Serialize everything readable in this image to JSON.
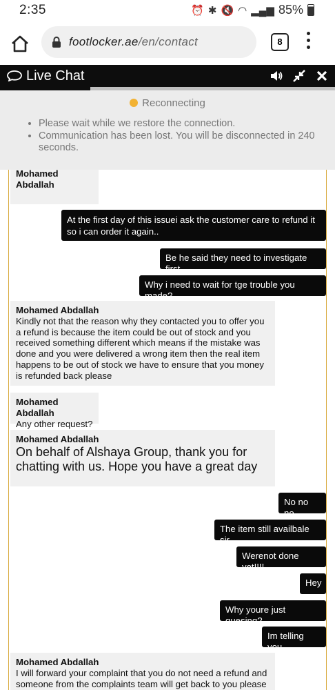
{
  "status_bar": {
    "time": "2:35",
    "battery": "85%"
  },
  "browser": {
    "url_domain": "footlocker.ae",
    "url_path": "/en/contact",
    "tab_count": "8"
  },
  "chat": {
    "title": "Live Chat",
    "status": "Reconnecting",
    "notices": [
      "Please wait while we restore the connection.",
      "Communication has been lost. You will be disconnected in 240 seconds."
    ]
  },
  "messages": [
    {
      "sender": "Mohamed Abdallah",
      "from": "agent",
      "text": ""
    },
    {
      "from": "user",
      "text": "At the first day of this issuei ask the customer care to refund it so i can order it again.."
    },
    {
      "from": "user",
      "text": "Be he said they need to investigate first"
    },
    {
      "from": "user",
      "text": "Why i need to wait for tge trouble you made?"
    },
    {
      "sender": "Mohamed Abdallah",
      "from": "agent",
      "text": "Kindly not that the reason why they contacted you to offer you a refund is because the item could be out of stock and you received something different which means if the mistake was done and you were delivered a wrong item then the real item happens to be out of stock we have to ensure that you money is refunded back please"
    },
    {
      "sender": "Mohamed Abdallah",
      "from": "agent",
      "text": "Any other request?"
    },
    {
      "sender": "Mohamed Abdallah",
      "from": "agent",
      "text": "On behalf of Alshaya Group, thank you for chatting with us. Hope you have a great day"
    },
    {
      "from": "user",
      "text": "No no no"
    },
    {
      "from": "user",
      "text": "The item still availbale sir"
    },
    {
      "from": "user",
      "text": "Werenot done yet!!!!"
    },
    {
      "from": "user",
      "text": "Hey"
    },
    {
      "from": "user",
      "text": "Why youre just guesing?"
    },
    {
      "from": "user",
      "text": "Im telling you"
    },
    {
      "sender": "Mohamed Abdallah",
      "from": "agent",
      "text": "I will forward your complaint that you do not need a refund and someone from the complaints team will get back to you please"
    }
  ],
  "colors": {
    "header_bg": "#0d0d0d",
    "status_dot": "#f2b233",
    "chat_border": "#d9a93c",
    "user_bubble": "#0a0a0a",
    "agent_bubble": "#f0f0f0"
  }
}
